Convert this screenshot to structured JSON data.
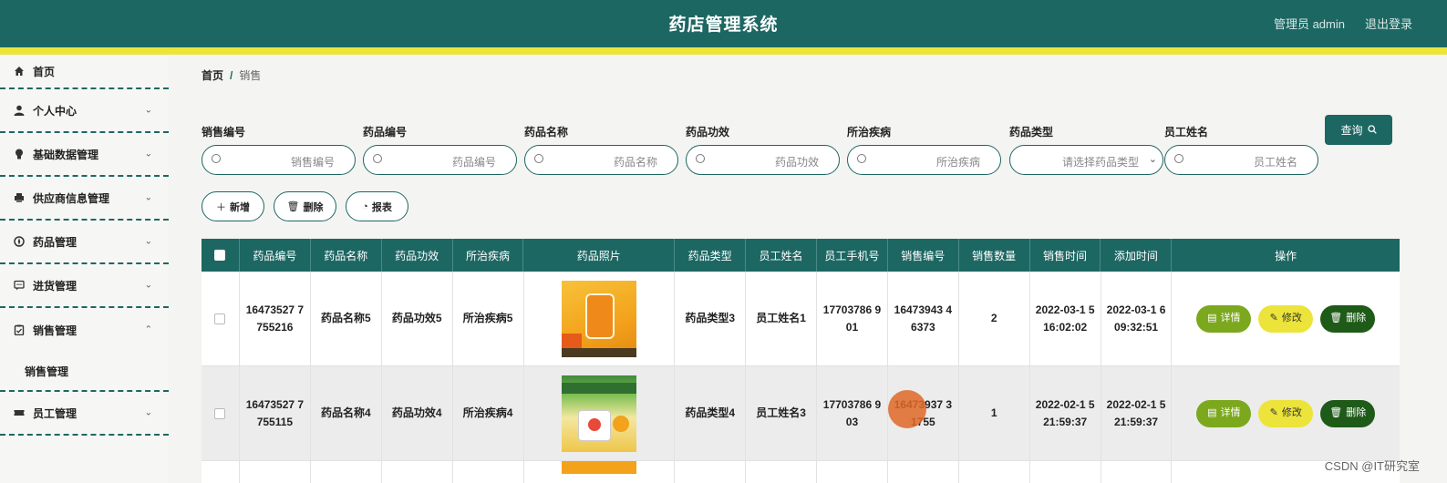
{
  "header": {
    "title": "药店管理系统",
    "user": "管理员 admin",
    "logout": "退出登录"
  },
  "sidebar": {
    "items": [
      {
        "label": "首页",
        "icon": "home-icon"
      },
      {
        "label": "个人中心",
        "icon": "person-icon"
      },
      {
        "label": "基础数据管理",
        "icon": "bulb-icon"
      },
      {
        "label": "供应商信息管理",
        "icon": "printer-icon"
      },
      {
        "label": "药品管理",
        "icon": "compass-icon"
      },
      {
        "label": "进货管理",
        "icon": "chat-icon"
      },
      {
        "label": "销售管理",
        "icon": "clipboard-icon"
      },
      {
        "label": "员工管理",
        "icon": "ticket-icon"
      }
    ],
    "subitems": {
      "sales": "销售管理"
    }
  },
  "breadcrumb": {
    "home": "首页",
    "separator": "/",
    "current": "销售"
  },
  "filters": [
    {
      "label": "销售编号",
      "placeholder": "销售编号"
    },
    {
      "label": "药品编号",
      "placeholder": "药品编号"
    },
    {
      "label": "药品名称",
      "placeholder": "药品名称"
    },
    {
      "label": "药品功效",
      "placeholder": "药品功效"
    },
    {
      "label": "所治疾病",
      "placeholder": "所治疾病"
    },
    {
      "label": "药品类型",
      "placeholder": "请选择药品类型"
    },
    {
      "label": "员工姓名",
      "placeholder": "员工姓名"
    }
  ],
  "query_button": "查询",
  "actions": {
    "add": "新增",
    "delete": "删除",
    "report": "报表"
  },
  "table": {
    "columns": [
      "药品编号",
      "药品名称",
      "药品功效",
      "所治疾病",
      "药品照片",
      "药品类型",
      "员工姓名",
      "员工手机号",
      "销售编号",
      "销售数量",
      "销售时间",
      "添加时间",
      "操作"
    ],
    "rows": [
      {
        "drug_no": "16473527 7755216",
        "drug_name": "药品名称5",
        "efficacy": "药品功效5",
        "disease": "所治疾病5",
        "type": "药品类型3",
        "staff": "员工姓名1",
        "phone": "17703786 901",
        "sale_no": "16473943 46373",
        "qty": "2",
        "sale_time": "2022-03-1 5 16:02:02",
        "add_time": "2022-03-1 6 09:32:51"
      },
      {
        "drug_no": "16473527 7755115",
        "drug_name": "药品名称4",
        "efficacy": "药品功效4",
        "disease": "所治疾病4",
        "type": "药品类型4",
        "staff": "员工姓名3",
        "phone": "17703786 903",
        "sale_no": "16473937 31755",
        "qty": "1",
        "sale_time": "2022-02-1 5 21:59:37",
        "add_time": "2022-02-1 5 21:59:37"
      }
    ],
    "ops": {
      "detail": "详情",
      "edit": "修改",
      "delete": "删除"
    }
  },
  "watermark": "CSDN @IT研究室",
  "colors": {
    "primary": "#1d6763",
    "accent": "#ece43a",
    "detail": "#7ca81e",
    "delete": "#1e5a18"
  }
}
